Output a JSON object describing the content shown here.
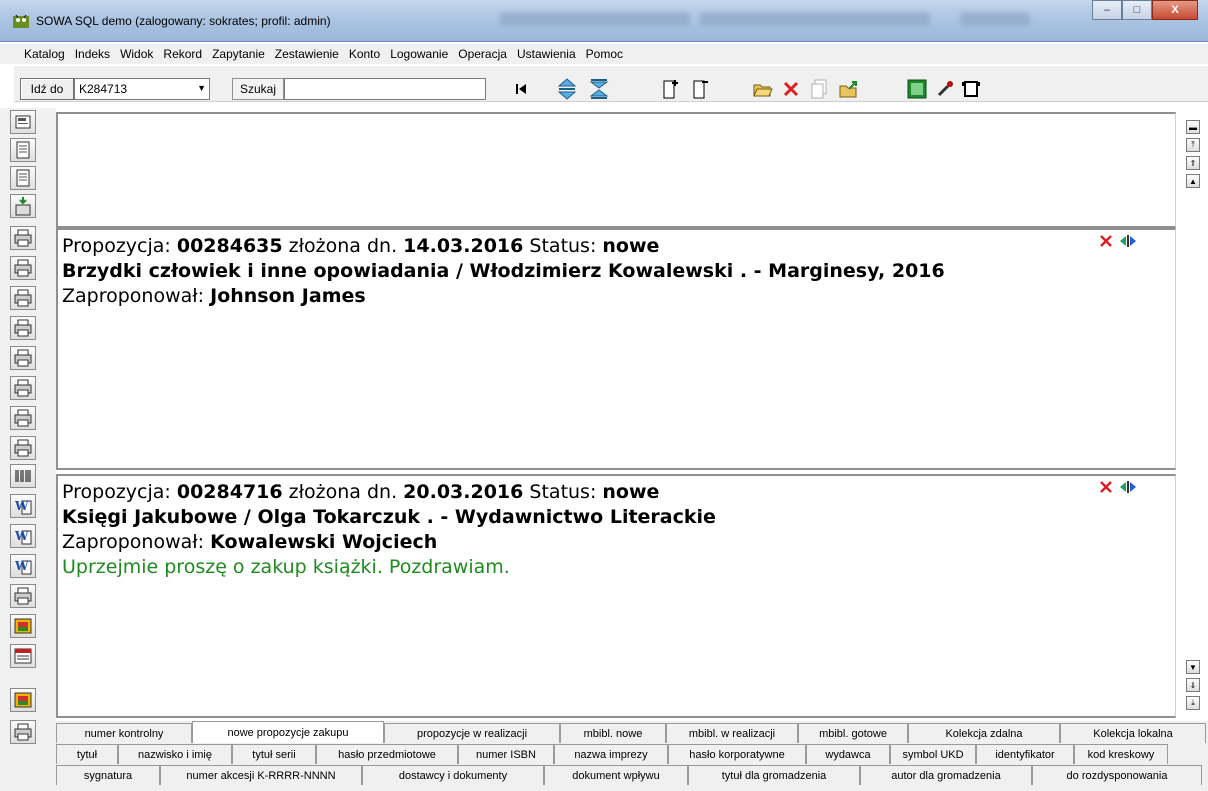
{
  "window": {
    "title": "SOWA SQL demo (zalogowany: sokrates; profil: admin)",
    "minimize_label": "–",
    "maximize_label": "□",
    "close_label": "X"
  },
  "menu": [
    "Katalog",
    "Indeks",
    "Widok",
    "Rekord",
    "Zapytanie",
    "Zestawienie",
    "Konto",
    "Logowanie",
    "Operacja",
    "Ustawienia",
    "Pomoc"
  ],
  "toolbar": {
    "goto_label": "Idź do",
    "goto_value": "K284713",
    "search_label": "Szukaj",
    "search_value": ""
  },
  "records": [
    {
      "label_proposal": "Propozycja: ",
      "id": "00284635",
      "label_date": " złożona dn. ",
      "date": "14.03.2016",
      "label_status": " Status: ",
      "status": "nowe",
      "title": "Brzydki człowiek i inne opowiadania / Włodzimierz Kowalewski . - Marginesy, 2016",
      "label_proposer": "Zaproponował: ",
      "proposer": "Johnson James",
      "comment": ""
    },
    {
      "label_proposal": "Propozycja: ",
      "id": "00284716",
      "label_date": " złożona dn. ",
      "date": "20.03.2016",
      "label_status": " Status: ",
      "status": "nowe",
      "title": "Księgi Jakubowe / Olga Tokarczuk . - Wydawnictwo Literackie",
      "label_proposer": "Zaproponował: ",
      "proposer": "Kowalewski Wojciech",
      "comment": "Uprzejmie proszę o zakup książki. Pozdrawiam."
    }
  ],
  "tabs": {
    "row1": [
      "numer kontrolny",
      "nowe propozycje zakupu",
      "propozycje w realizacji",
      "mbibl. nowe",
      "mbibl. w realizacji",
      "mbibl. gotowe",
      "Kolekcja zdalna",
      "Kolekcja lokalna"
    ],
    "row1_active": "nowe propozycje zakupu",
    "row2": [
      "tytuł",
      "nazwisko i imię",
      "tytuł serii",
      "hasło przedmiotowe",
      "numer ISBN",
      "nazwa imprezy",
      "hasło korporatywne",
      "wydawca",
      "symbol UKD",
      "identyfikator",
      "kod kreskowy"
    ],
    "row3": [
      "sygnatura",
      "numer akcesji K-RRRR-NNNN",
      "dostawcy i dokumenty",
      "dokument wpływu",
      "tytuł dla gromadzenia",
      "autor dla gromadzenia",
      "do rozdysponowania"
    ]
  },
  "icons": {
    "leftbar": [
      "card-icon",
      "document-icon",
      "document-icon",
      "iso-import-icon",
      "printer-icon",
      "printer-icon",
      "printer-icon",
      "printer-icon",
      "printer-icon",
      "printer-icon",
      "printer-icon",
      "printer-icon",
      "barcode-icon",
      "word-icon",
      "word-icon",
      "word-icon",
      "printer-icon",
      "printer-color-icon",
      "zob-icon",
      "printer-color-icon",
      "printer-icon"
    ]
  },
  "colors": {
    "comment_green": "#1e8b1e",
    "delete_red": "#e02020",
    "move_green": "#1aa35a",
    "move_blue": "#2a5bd7"
  }
}
